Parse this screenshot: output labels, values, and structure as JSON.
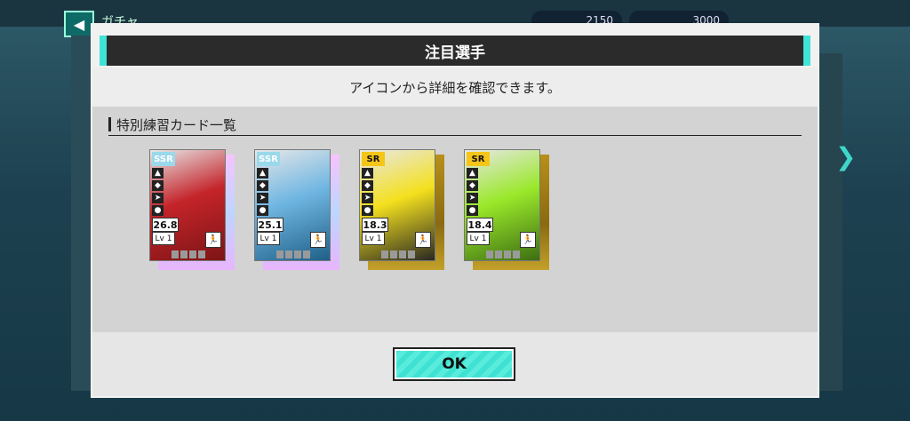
{
  "background": {
    "back_icon": "chevron-left-icon",
    "title": "ガチャ",
    "currency_1": "2150",
    "currency_2": "3000"
  },
  "dialog": {
    "title": "注目選手",
    "subtitle": "アイコンから詳細を確認できます。",
    "section_title": "特別練習カード一覧",
    "ok_label": "OK"
  },
  "cards": [
    {
      "rarity": "SSR",
      "rating": "26.8",
      "level": "Lv 1",
      "photo_colors": [
        "#c4242a",
        "#7a1414"
      ]
    },
    {
      "rarity": "SSR",
      "rating": "25.1",
      "level": "Lv 1",
      "photo_colors": [
        "#6fb6e2",
        "#1d5d86"
      ]
    },
    {
      "rarity": "SR",
      "rating": "18.3",
      "level": "Lv 1",
      "photo_colors": [
        "#f4e01e",
        "#222222"
      ]
    },
    {
      "rarity": "SR",
      "rating": "18.4",
      "level": "Lv 1",
      "photo_colors": [
        "#9ae82a",
        "#3a6a12"
      ]
    }
  ],
  "colors": {
    "accent": "#3fe3d8",
    "titlebar": "#2b2b2b"
  }
}
